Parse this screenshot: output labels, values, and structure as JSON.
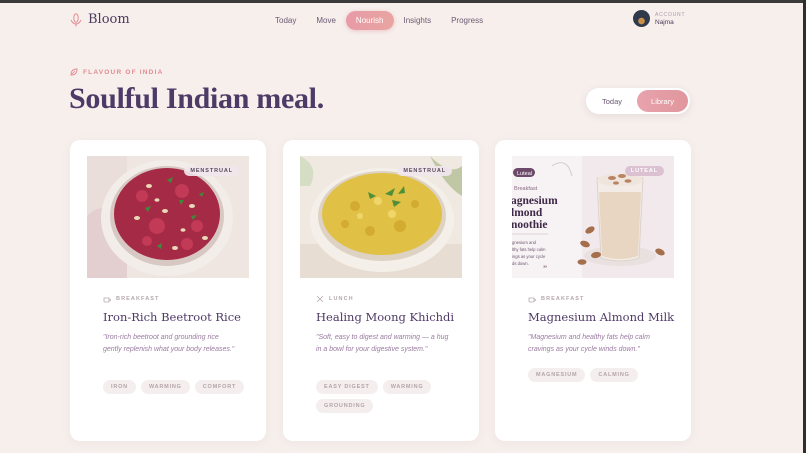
{
  "app": {
    "name": "Bloom"
  },
  "nav": {
    "items": [
      {
        "label": "Today"
      },
      {
        "label": "Move"
      },
      {
        "label": "Nourish",
        "active": true
      },
      {
        "label": "Insights"
      },
      {
        "label": "Progress"
      }
    ]
  },
  "account": {
    "label": "ACCOUNT",
    "name": "Najma"
  },
  "page": {
    "eyebrow": "FLAVOUR OF INDIA",
    "title": "Soulful Indian meal."
  },
  "toggle": {
    "today": "Today",
    "library": "Library",
    "selected": "Library"
  },
  "cards": [
    {
      "badge": "MENSTRUAL",
      "meal": "BREAKFAST",
      "title": "Iron-Rich Beetroot Rice",
      "quote": "\"Iron-rich beetroot and grounding rice gently replenish what your body releases.\"",
      "tags": [
        "IRON",
        "WARMING",
        "COMFORT"
      ],
      "image": "beetroot-rice-bowl"
    },
    {
      "badge": "MENSTRUAL",
      "meal": "LUNCH",
      "title": "Healing Moong Khichdi",
      "quote": "\"Soft, easy to digest and warming — a hug in a bowl for your digestive system.\"",
      "tags": [
        "EASY DIGEST",
        "WARMING",
        "GROUNDING"
      ],
      "image": "moong-khichdi-bowl"
    },
    {
      "badge": "LUTEAL",
      "meal": "BREAKFAST",
      "title": "Magnesium Almond Milk",
      "quote": "\"Magnesium and healthy fats help calm cravings as your cycle winds down.\"",
      "tags": [
        "MAGNESIUM",
        "CALMING"
      ],
      "image": "almond-milk-glass",
      "image_text": {
        "chip": "Luteal",
        "kicker": "Breakfast",
        "headline": [
          "agnesium",
          "lmond",
          "noothie"
        ],
        "body": [
          "gnesium and",
          "lthy fats help calm",
          "ings as your cycle",
          "ds down."
        ]
      }
    }
  ],
  "colors": {
    "accent": "#e89aa8",
    "title": "#4e3a66",
    "background": "#f6efec"
  }
}
